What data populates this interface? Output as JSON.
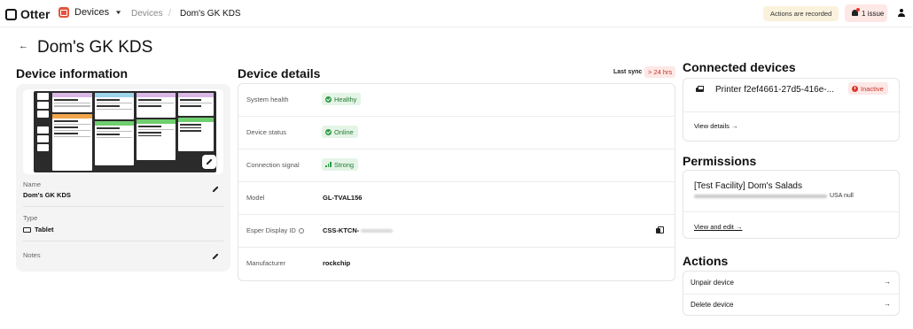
{
  "topbar": {
    "logo_text": "Otter",
    "app_name": "Devices",
    "breadcrumb": [
      "Devices",
      "Dom's GK KDS"
    ],
    "recording_notice": "Actions are recorded",
    "issues_label": "1 issue"
  },
  "page": {
    "title": "Dom's GK KDS"
  },
  "device_information": {
    "heading": "Device information",
    "fields": [
      {
        "label": "Name",
        "value": "Dom's GK KDS"
      },
      {
        "label": "Type",
        "value": "Tablet"
      },
      {
        "label": "Notes",
        "value": ""
      }
    ]
  },
  "device_details": {
    "heading": "Device details",
    "last_sync_label": "Last sync",
    "last_sync_value": "> 24 hrs",
    "rows": [
      {
        "label": "System health",
        "value": "Healthy",
        "status": "ok"
      },
      {
        "label": "Device status",
        "value": "Online",
        "status": "ok"
      },
      {
        "label": "Connection signal",
        "value": "Strong",
        "status": "ok"
      },
      {
        "label": "Model",
        "value": "GL-TVAL156"
      },
      {
        "label": "Esper Display ID",
        "value": "CSS-KTCN-"
      },
      {
        "label": "Manufacturer",
        "value": "rockchip"
      }
    ]
  },
  "connected_devices": {
    "heading": "Connected devices",
    "printer_name": "Printer f2ef4661-27d5-416e-...",
    "printer_status": "Inactive",
    "view_details": "View details →"
  },
  "permissions": {
    "heading": "Permissions",
    "facility_name": "[Test Facility] Dom's Salads",
    "address_suffix": "USA null",
    "view_edit": "View and edit →"
  },
  "actions": {
    "heading": "Actions",
    "items": [
      "Unpair device",
      "Delete device"
    ]
  },
  "colors": {
    "accent_red": "#e5533d",
    "success_green": "#2e9b45",
    "danger_red": "#d83a2f",
    "warning_bg": "#faf2dc"
  },
  "icons": [
    "logo-icon",
    "devices-app-icon",
    "chevron-down-icon",
    "bell-icon",
    "user-icon",
    "back-arrow-icon",
    "pencil-icon",
    "tablet-icon",
    "check-circle-icon",
    "signal-icon",
    "info-icon",
    "copy-icon",
    "printer-icon",
    "alert-circle-icon",
    "arrow-right-icon"
  ]
}
